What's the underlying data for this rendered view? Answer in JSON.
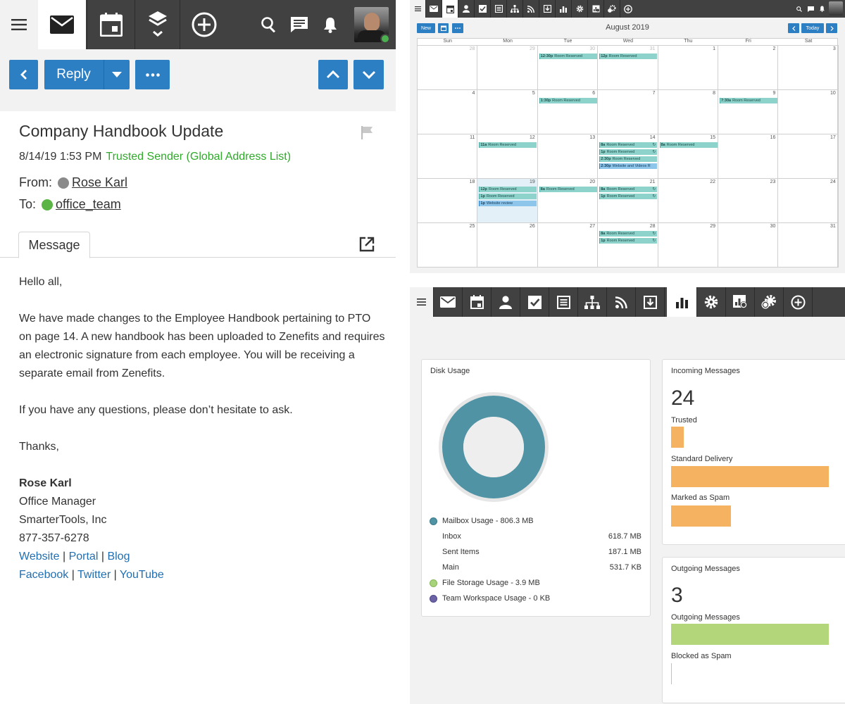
{
  "email": {
    "toolbar": {
      "reply_label": "Reply"
    },
    "subject": "Company Handbook Update",
    "datetime": "8/14/19 1:53 PM",
    "trust": "Trusted Sender (Global Address List)",
    "from_label": "From:",
    "from_name": "Rose Karl",
    "to_label": "To:",
    "to_name": "office_team",
    "tab_label": "Message",
    "body": {
      "greeting": "Hello all,",
      "para1": "We have made changes to the Employee Handbook pertaining to PTO on page 14.  A new handbook has been uploaded to Zenefits and requires an electronic signature from each employee.  You will be receiving a separate email from Zenefits.",
      "para2": "If you have any questions, please don’t hesitate to ask.",
      "closing": "Thanks,",
      "sig_name": "Rose Karl",
      "sig_title": "Office Manager",
      "sig_company": "SmarterTools, Inc",
      "sig_phone": "877-357-6278",
      "links1": [
        "Website",
        "Portal",
        "Blog"
      ],
      "links2": [
        "Facebook",
        "Twitter",
        "YouTube"
      ],
      "link_sep": "|"
    },
    "status_color": "#4caf50",
    "from_dot_color": "#8a8a8a",
    "to_dot_color": "#5ab546"
  },
  "calendar": {
    "new_label": "New",
    "month_title": "August 2019",
    "today_label": "Today",
    "days": [
      "Sun",
      "Mon",
      "Tue",
      "Wed",
      "Thu",
      "Fri",
      "Sat"
    ],
    "weeks": [
      [
        {
          "n": "28",
          "o": true
        },
        {
          "n": "29",
          "o": true
        },
        {
          "n": "30",
          "o": true
        },
        {
          "n": "31",
          "o": true
        },
        {
          "n": "1"
        },
        {
          "n": "2"
        },
        {
          "n": "3"
        }
      ],
      [
        {
          "n": "4"
        },
        {
          "n": "5"
        },
        {
          "n": "6"
        },
        {
          "n": "7"
        },
        {
          "n": "8"
        },
        {
          "n": "9"
        },
        {
          "n": "10"
        }
      ],
      [
        {
          "n": "11"
        },
        {
          "n": "12"
        },
        {
          "n": "13"
        },
        {
          "n": "14"
        },
        {
          "n": "15"
        },
        {
          "n": "16"
        },
        {
          "n": "17"
        }
      ],
      [
        {
          "n": "18"
        },
        {
          "n": "19",
          "today": true
        },
        {
          "n": "20"
        },
        {
          "n": "21"
        },
        {
          "n": "22"
        },
        {
          "n": "23"
        },
        {
          "n": "24"
        }
      ],
      [
        {
          "n": "25"
        },
        {
          "n": "26"
        },
        {
          "n": "27"
        },
        {
          "n": "28"
        },
        {
          "n": "29"
        },
        {
          "n": "30"
        },
        {
          "n": "31"
        }
      ]
    ],
    "events": [
      {
        "w": 0,
        "d": 2,
        "t": "12:30p",
        "title": "Room Reserved"
      },
      {
        "w": 0,
        "d": 3,
        "t": "12p",
        "title": "Room Reserved"
      },
      {
        "w": 1,
        "d": 2,
        "t": "1:30p",
        "title": "Room Reserved"
      },
      {
        "w": 1,
        "d": 5,
        "t": "7:30a",
        "title": "Room Reserved"
      },
      {
        "w": 2,
        "d": 1,
        "t": "11a",
        "title": "Room Reserved"
      },
      {
        "w": 2,
        "d": 3,
        "t": "8a",
        "title": "Room Reserved",
        "r": true
      },
      {
        "w": 2,
        "d": 3,
        "t": "1p",
        "title": "Room Reserved",
        "r": true
      },
      {
        "w": 2,
        "d": 3,
        "t": "2:30p",
        "title": "Room Reserved"
      },
      {
        "w": 2,
        "d": 3,
        "t": "2:30p",
        "title": "Website and Videos R",
        "blue": true
      },
      {
        "w": 2,
        "d": 4,
        "t": "8a",
        "title": "Room Reserved"
      },
      {
        "w": 3,
        "d": 1,
        "t": "12p",
        "title": "Room Reserved"
      },
      {
        "w": 3,
        "d": 1,
        "t": "1p",
        "title": "Room Reserved"
      },
      {
        "w": 3,
        "d": 1,
        "t": "1p",
        "title": "Website review",
        "blue": true
      },
      {
        "w": 3,
        "d": 2,
        "t": "8a",
        "title": "Room Reserved"
      },
      {
        "w": 3,
        "d": 3,
        "t": "8a",
        "title": "Room Reserved",
        "r": true
      },
      {
        "w": 3,
        "d": 3,
        "t": "1p",
        "title": "Room Reserved",
        "r": true
      },
      {
        "w": 4,
        "d": 3,
        "t": "8a",
        "title": "Room Reserved",
        "r": true
      },
      {
        "w": 4,
        "d": 3,
        "t": "1p",
        "title": "Room Reserved",
        "r": true
      }
    ]
  },
  "dashboard": {
    "disk": {
      "title": "Disk Usage",
      "mailbox": "Mailbox Usage - 806.3 MB",
      "rows": [
        {
          "label": "Inbox",
          "value": "618.7 MB"
        },
        {
          "label": "Sent Items",
          "value": "187.1 MB"
        },
        {
          "label": "Main",
          "value": "531.7 KB"
        }
      ],
      "file_storage": "File Storage Usage - 3.9 MB",
      "team": "Team Workspace Usage - 0 KB",
      "mailbox_color": "#4f93a5",
      "file_color": "#a7d37a",
      "team_color": "#6b63a6"
    },
    "incoming": {
      "title": "Incoming Messages",
      "count": "24",
      "trusted_label": "Trusted",
      "trusted_fraction": 0.08,
      "standard_label": "Standard Delivery",
      "standard_fraction": 1.0,
      "spam_label": "Marked as Spam",
      "spam_fraction": 0.38,
      "bar_color": "#f5b362"
    },
    "outgoing": {
      "title": "Outgoing Messages",
      "count": "3",
      "out_label": "Outgoing Messages",
      "out_fraction": 1.0,
      "blocked_label": "Blocked as Spam",
      "blocked_fraction": 0.0,
      "bar_color": "#b3d67a"
    }
  }
}
